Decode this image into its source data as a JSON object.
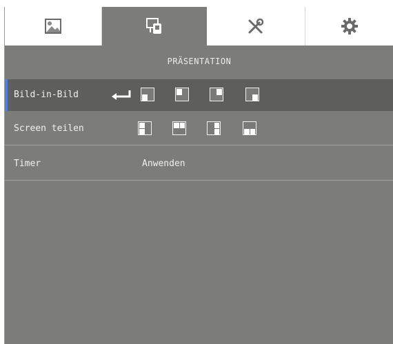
{
  "tabs": [
    {
      "icon": "picture-icon",
      "active": false
    },
    {
      "icon": "presentation-icon",
      "active": true
    },
    {
      "icon": "tools-icon",
      "active": false
    },
    {
      "icon": "gear-icon",
      "active": false
    }
  ],
  "section_title": "PRÄSENTATION",
  "rows": {
    "pip": {
      "label": "Bild-in-Bild",
      "options": [
        "pip-bottom-left",
        "pip-top-left",
        "pip-top-right",
        "pip-bottom-right"
      ]
    },
    "split": {
      "label": "Screen teilen",
      "options": [
        "split-layout-1",
        "split-layout-2",
        "split-layout-3",
        "split-layout-4"
      ]
    },
    "timer": {
      "label": "Timer",
      "value": "Anwenden"
    }
  },
  "colors": {
    "panel": "#7c7c7a",
    "selected_row": "#5e5e5c",
    "accent": "#4f7fd8"
  }
}
